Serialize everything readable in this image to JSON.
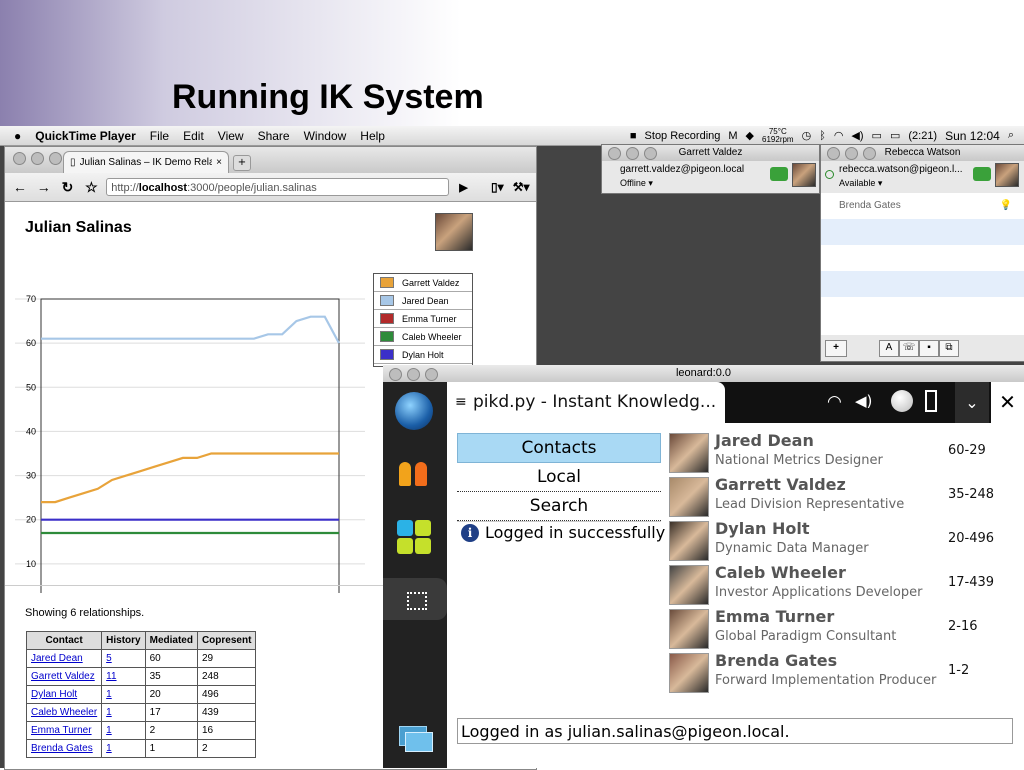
{
  "slide": {
    "title": "Running IK System"
  },
  "menubar": {
    "apple": "",
    "app_name": "QuickTime Player",
    "items": [
      "File",
      "Edit",
      "View",
      "Share",
      "Window",
      "Help"
    ],
    "stop_recording": "Stop Recording",
    "temp": "75°C",
    "rpm": "6192rpm",
    "battery": "(2:21)",
    "clock": "Sun 12:04"
  },
  "browser": {
    "tab_title": "Julian Salinas – IK Demo Rela",
    "url_prefix": "http://",
    "url_host": "localhost",
    "url_path": ":3000/people/julian.salinas",
    "page_heading": "Julian Salinas",
    "showing": "Showing 6 relationships.",
    "table": {
      "headers": [
        "Contact",
        "History",
        "Mediated",
        "Copresent"
      ],
      "rows": [
        [
          "Jared Dean",
          "5",
          "60",
          "29"
        ],
        [
          "Garrett Valdez",
          "11",
          "35",
          "248"
        ],
        [
          "Dylan Holt",
          "1",
          "20",
          "496"
        ],
        [
          "Caleb Wheeler",
          "1",
          "17",
          "439"
        ],
        [
          "Emma Turner",
          "1",
          "2",
          "16"
        ],
        [
          "Brenda Gates",
          "1",
          "1",
          "2"
        ]
      ]
    }
  },
  "chart_data": {
    "type": "line",
    "ylim": [
      0,
      70
    ],
    "yticks": [
      "0",
      "10",
      "20",
      "30",
      "40",
      "50",
      "60",
      "70"
    ],
    "points": 22,
    "series": [
      {
        "name": "Garrett Valdez",
        "color": "#e8a33a",
        "values": [
          24,
          24,
          25,
          26,
          27,
          29,
          30,
          31,
          32,
          33,
          34,
          34,
          35,
          35,
          35,
          35,
          35,
          35,
          35,
          35,
          35,
          35
        ]
      },
      {
        "name": "Jared Dean",
        "color": "#a7c7e7",
        "values": [
          61,
          61,
          61,
          61,
          61,
          61,
          61,
          61,
          61,
          61,
          61,
          61,
          61,
          61,
          61,
          61,
          62,
          62,
          65,
          66,
          66,
          60
        ]
      },
      {
        "name": "Emma Turner",
        "color": "#b22a2a",
        "values": [
          2,
          2,
          2,
          2,
          2,
          2,
          2,
          2,
          2,
          2,
          2,
          2,
          2,
          2,
          2,
          2,
          2,
          2,
          2,
          2,
          2,
          2
        ]
      },
      {
        "name": "Caleb Wheeler",
        "color": "#2e8b3a",
        "values": [
          17,
          17,
          17,
          17,
          17,
          17,
          17,
          17,
          17,
          17,
          17,
          17,
          17,
          17,
          17,
          17,
          17,
          17,
          17,
          17,
          17,
          17
        ]
      },
      {
        "name": "Dylan Holt",
        "color": "#3b2fc9",
        "values": [
          20,
          20,
          20,
          20,
          20,
          20,
          20,
          20,
          20,
          20,
          20,
          20,
          20,
          20,
          20,
          20,
          20,
          20,
          20,
          20,
          20,
          20
        ]
      },
      {
        "name": "Brenda Gates",
        "color": "#9a6b2f",
        "values": [
          1,
          1,
          1,
          1,
          1,
          1,
          1,
          1,
          1,
          1,
          1,
          1,
          1,
          1,
          1,
          1,
          1,
          1,
          1,
          1,
          1,
          1
        ]
      }
    ],
    "legend_items": [
      "Garrett Valdez",
      "Jared Dean",
      "Emma Turner",
      "Caleb Wheeler",
      "Dylan Holt",
      "Brenda Gates"
    ]
  },
  "chat_garrett": {
    "title": "Garrett Valdez",
    "email": "garrett.valdez@pigeon.local",
    "status": "Offline ▾"
  },
  "chat_rebecca": {
    "title": "Rebecca Watson",
    "email": "rebecca.watson@pigeon.l...",
    "status": "Available ▾",
    "buddy": "Brenda Gates"
  },
  "leonard": {
    "window_title": "leonard:0.0",
    "app_title": "pikd.py - Instant Knowledg...",
    "tabs": [
      "Contacts",
      "Local",
      "Search"
    ],
    "status": "Logged in successfully",
    "logged_in": "Logged in as julian.salinas@pigeon.local.",
    "contacts": [
      {
        "name": "Jared Dean",
        "title": "National Metrics Designer",
        "code": "60-29"
      },
      {
        "name": "Garrett Valdez",
        "title": "Lead Division Representative",
        "code": "35-248"
      },
      {
        "name": "Dylan Holt",
        "title": "Dynamic Data Manager",
        "code": "20-496"
      },
      {
        "name": "Caleb Wheeler",
        "title": "Investor Applications Developer",
        "code": "17-439"
      },
      {
        "name": "Emma Turner",
        "title": "Global Paradigm Consultant",
        "code": "2-16"
      },
      {
        "name": "Brenda Gates",
        "title": "Forward Implementation Producer",
        "code": "1-2"
      }
    ]
  }
}
